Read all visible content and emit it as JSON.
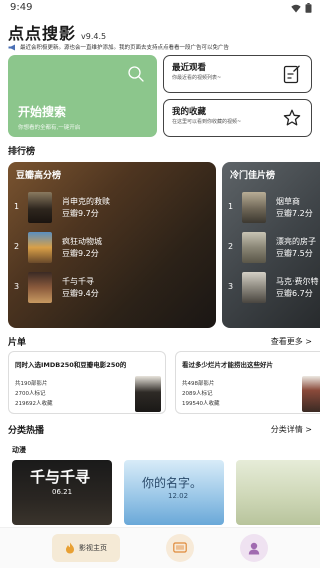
{
  "status_bar": {
    "time": "9:49"
  },
  "header": {
    "title": "点点搜影",
    "version": "v9.4.5"
  },
  "notice": {
    "text": "最近会积极更新。源也会一直维护添加。我的页面去支持点点看看一段广告可以免广告"
  },
  "quick": {
    "start": {
      "title": "开始搜索",
      "subtitle": "你想看的全都有,一键开启"
    },
    "recent": {
      "title": "最近观看",
      "subtitle": "你最近看的视频列表~"
    },
    "favorites": {
      "title": "我的收藏",
      "subtitle": "在这里可以看到你收藏的视频~"
    }
  },
  "ranking": {
    "title": "排行榜",
    "boards": [
      {
        "title": "豆瓣高分榜",
        "items": [
          {
            "rank": "1",
            "name": "肖申克的救赎",
            "score": "豆瓣9.7分"
          },
          {
            "rank": "2",
            "name": "疯狂动物城",
            "score": "豆瓣9.2分"
          },
          {
            "rank": "3",
            "name": "千与千寻",
            "score": "豆瓣9.4分"
          }
        ]
      },
      {
        "title": "冷门佳片榜",
        "items": [
          {
            "rank": "1",
            "name": "烟草商",
            "score": "豆瓣7.2分"
          },
          {
            "rank": "2",
            "name": "漂亮的房子",
            "score": "豆瓣7.5分"
          },
          {
            "rank": "3",
            "name": "马克·费尔特",
            "score": "豆瓣6.7分"
          }
        ]
      }
    ]
  },
  "playlists": {
    "title": "片单",
    "more": "查看更多 >",
    "cards": [
      {
        "title": "同时入选IMDB250和豆瓣电影250的",
        "count": "共190部影片",
        "marks": "2700人标记",
        "saves": "219692人收藏"
      },
      {
        "title": "看过多少烂片才能捞出这些好片",
        "count": "共498部影片",
        "marks": "2089人标记",
        "saves": "199540人收藏"
      }
    ]
  },
  "genres": {
    "title": "分类热播",
    "more": "分类详情 >",
    "category": "动漫",
    "posters": [
      {
        "text": "千与千寻",
        "date": "06.21"
      },
      {
        "text": "你的名字。",
        "date": "12.02"
      },
      {
        "text": ""
      }
    ]
  },
  "bottom_nav": {
    "home_label": "影视主页"
  },
  "colors": {
    "accent_green": "#8cc68c",
    "nav_home_bg": "#f5ead6",
    "rank_card_bg": "#4e3520"
  }
}
